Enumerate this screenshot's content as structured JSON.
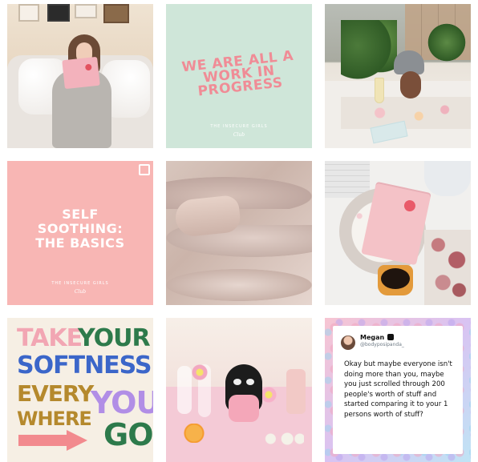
{
  "posts": {
    "quote_work_in_progress": {
      "lines": [
        "WE ARE ALL A",
        "WORK IN",
        "PROGRESS"
      ],
      "brand": "THE INSECURE GIRLS",
      "brand_script": "Club"
    },
    "quote_self_soothing": {
      "lines": [
        "SELF",
        "SOOTHING:",
        "THE BASICS"
      ],
      "brand": "THE INSECURE GIRLS",
      "brand_script": "Club"
    },
    "poster_take_your_softness": {
      "words": {
        "take": "TAKE",
        "your": "YOUR",
        "softness": "SOFTNESS",
        "every": "EVERY",
        "where": "WHERE",
        "you": "YOU",
        "go": "GO"
      }
    },
    "tweet": {
      "name": "Megan",
      "handle": "@bodyposipanda_",
      "text": "Okay but maybe everyone isn't doing more than you, maybe you just scrolled through 200 people's worth of stuff and started comparing it to your 1 persons worth of stuff?"
    }
  },
  "colors": {
    "mint": "#cfe6d9",
    "pink": "#f8b6b4",
    "poster_pink": "#f2a6b3",
    "poster_green": "#2d7a4b",
    "poster_blue": "#3b66c9",
    "poster_gold": "#b5892d",
    "poster_lilac": "#b18ee6",
    "arrow_coral": "#f28a8e"
  },
  "icons": {
    "multi_post": "multiple-images-icon"
  }
}
